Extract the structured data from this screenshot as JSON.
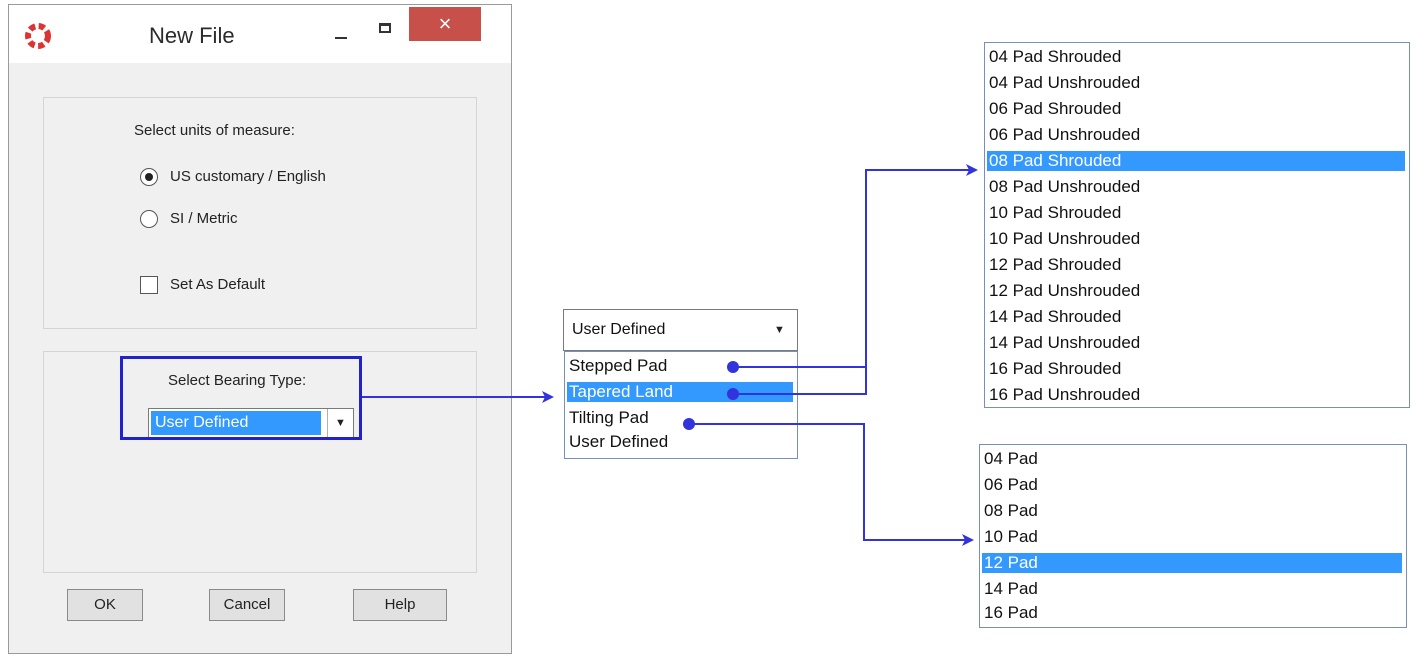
{
  "dialog": {
    "title": "New File",
    "close_glyph": "×",
    "units_label": "Select units of measure:",
    "units_options": [
      {
        "label": "US customary / English",
        "selected": true
      },
      {
        "label": "SI / Metric",
        "selected": false
      }
    ],
    "set_default_label": "Set As Default",
    "set_default_checked": false,
    "bearing_label": "Select Bearing Type:",
    "bearing_value": "User Defined",
    "buttons": {
      "ok": "OK",
      "cancel": "Cancel",
      "help": "Help"
    }
  },
  "bearing_dropdown": {
    "value": "User Defined",
    "arrow": "▼",
    "options": [
      {
        "label": "Stepped Pad",
        "selected": false
      },
      {
        "label": "Tapered Land",
        "selected": true
      },
      {
        "label": "Tilting Pad",
        "selected": false
      },
      {
        "label": "User Defined",
        "selected": false
      }
    ]
  },
  "pad_list_shrouded": {
    "items": [
      {
        "label": "04 Pad Shrouded",
        "selected": false
      },
      {
        "label": "04 Pad Unshrouded",
        "selected": false
      },
      {
        "label": "06 Pad Shrouded",
        "selected": false
      },
      {
        "label": "06 Pad Unshrouded",
        "selected": false
      },
      {
        "label": "08 Pad Shrouded",
        "selected": true
      },
      {
        "label": "08 Pad Unshrouded",
        "selected": false
      },
      {
        "label": "10 Pad Shrouded",
        "selected": false
      },
      {
        "label": "10 Pad Unshrouded",
        "selected": false
      },
      {
        "label": "12 Pad Shrouded",
        "selected": false
      },
      {
        "label": "12 Pad Unshrouded",
        "selected": false
      },
      {
        "label": "14 Pad Shrouded",
        "selected": false
      },
      {
        "label": "14 Pad Unshrouded",
        "selected": false
      },
      {
        "label": "16 Pad Shrouded",
        "selected": false
      },
      {
        "label": "16 Pad Unshrouded",
        "selected": false
      }
    ]
  },
  "pad_list_tilting": {
    "items": [
      {
        "label": "04 Pad",
        "selected": false
      },
      {
        "label": "06 Pad",
        "selected": false
      },
      {
        "label": "08 Pad",
        "selected": false
      },
      {
        "label": "10 Pad",
        "selected": false
      },
      {
        "label": "12 Pad",
        "selected": true
      },
      {
        "label": "14 Pad",
        "selected": false
      },
      {
        "label": "16 Pad",
        "selected": false
      }
    ]
  },
  "colors": {
    "selection": "#3399ff",
    "connector": "#3333dd",
    "close_button": "#c7504a",
    "highlight_box": "#2222cc"
  }
}
